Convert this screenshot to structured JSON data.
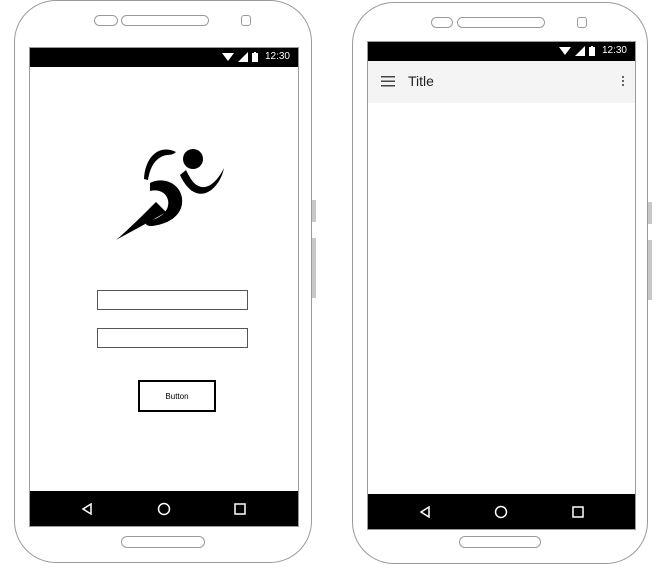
{
  "phone_left": {
    "status_time": "12:30",
    "button_label": "Button",
    "nav": [
      "back",
      "home",
      "recents"
    ]
  },
  "phone_right": {
    "status_time": "12:30",
    "appbar_title": "Title",
    "nav": [
      "back",
      "home",
      "recents"
    ]
  },
  "icons": {
    "logo": "running-man-icon",
    "menu": "hamburger-menu-icon",
    "overflow": "more-vert-icon",
    "wifi": "wifi-icon",
    "signal": "signal-icon",
    "battery": "battery-icon"
  },
  "colors": {
    "bars": "#000000",
    "appbar": "#f4f4f4"
  }
}
